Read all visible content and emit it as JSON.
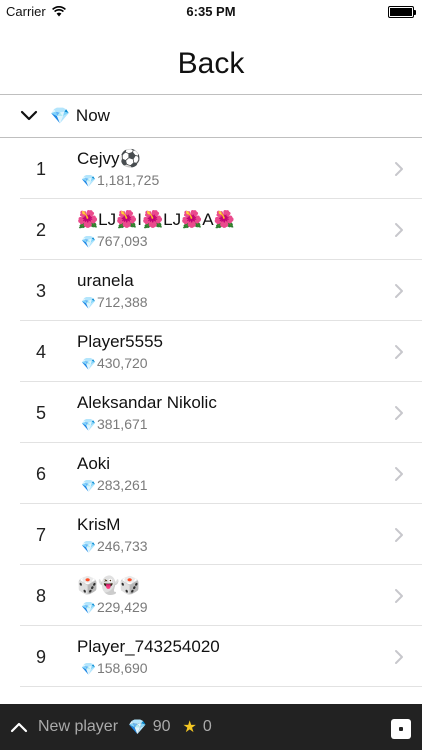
{
  "status_bar": {
    "carrier": "Carrier",
    "time": "6:35 PM"
  },
  "header": {
    "title": "Back"
  },
  "filter": {
    "icon": "gem-icon",
    "label": "Now"
  },
  "leaderboard": [
    {
      "rank": "1",
      "name": "Cejvy⚽",
      "score": "1,181,725"
    },
    {
      "rank": "2",
      "name": "🌺LJ🌺I🌺LJ🌺A🌺",
      "score": "767,093"
    },
    {
      "rank": "3",
      "name": "uranela",
      "score": "712,388"
    },
    {
      "rank": "4",
      "name": "Player5555",
      "score": "430,720"
    },
    {
      "rank": "5",
      "name": "Aleksandar Nikolic",
      "score": "381,671"
    },
    {
      "rank": "6",
      "name": "Aoki",
      "score": "283,261"
    },
    {
      "rank": "7",
      "name": "KrisM",
      "score": "246,733"
    },
    {
      "rank": "8",
      "name": "🎲👻🎲",
      "score": "229,429"
    },
    {
      "rank": "9",
      "name": "Player_743254020",
      "score": "158,690"
    }
  ],
  "bottom_bar": {
    "player_name": "New player",
    "gems": "90",
    "stars": "0",
    "star_color": "#f3c623"
  }
}
